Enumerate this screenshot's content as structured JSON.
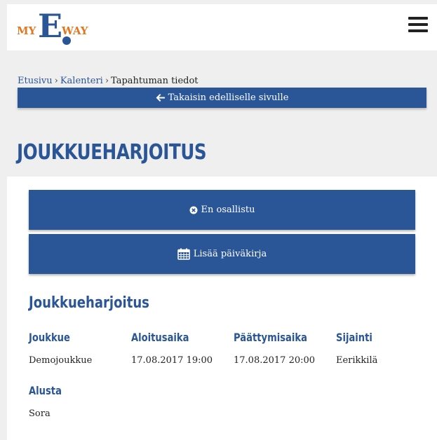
{
  "header": {
    "logo": {
      "part1": "MY",
      "part2": "E",
      "part3": "WAY"
    },
    "menu_icon": "hamburger-menu-icon"
  },
  "breadcrumb": {
    "items": [
      "Etusivu",
      "Kalenteri",
      "Tapahtuman tiedot"
    ],
    "separator": "›"
  },
  "back_bar": {
    "icon": "arrow-left-icon",
    "label": "Takaisin edelliselle sivulle"
  },
  "page_title": "JOUKKUEHARJOITUS",
  "actions": [
    {
      "icon": "circle-x-icon",
      "label": "En osallistu"
    },
    {
      "icon": "calendar-icon",
      "label": "Lisää päiväkirja"
    }
  ],
  "details": {
    "title": "Joukkueharjoitus",
    "fields": [
      {
        "label": "Joukkue",
        "value": "Demojoukkue"
      },
      {
        "label": "Aloitusaika",
        "value": "17.08.2017 19:00"
      },
      {
        "label": "Päättymisaika",
        "value": "17.08.2017 20:00"
      },
      {
        "label": "Sijainti",
        "value": "Eerikkilä"
      },
      {
        "label": "Alusta",
        "value": "Sora"
      }
    ]
  },
  "colors": {
    "primary": "#2a5596",
    "accent": "#e1771f",
    "background_grey": "#efefef"
  }
}
